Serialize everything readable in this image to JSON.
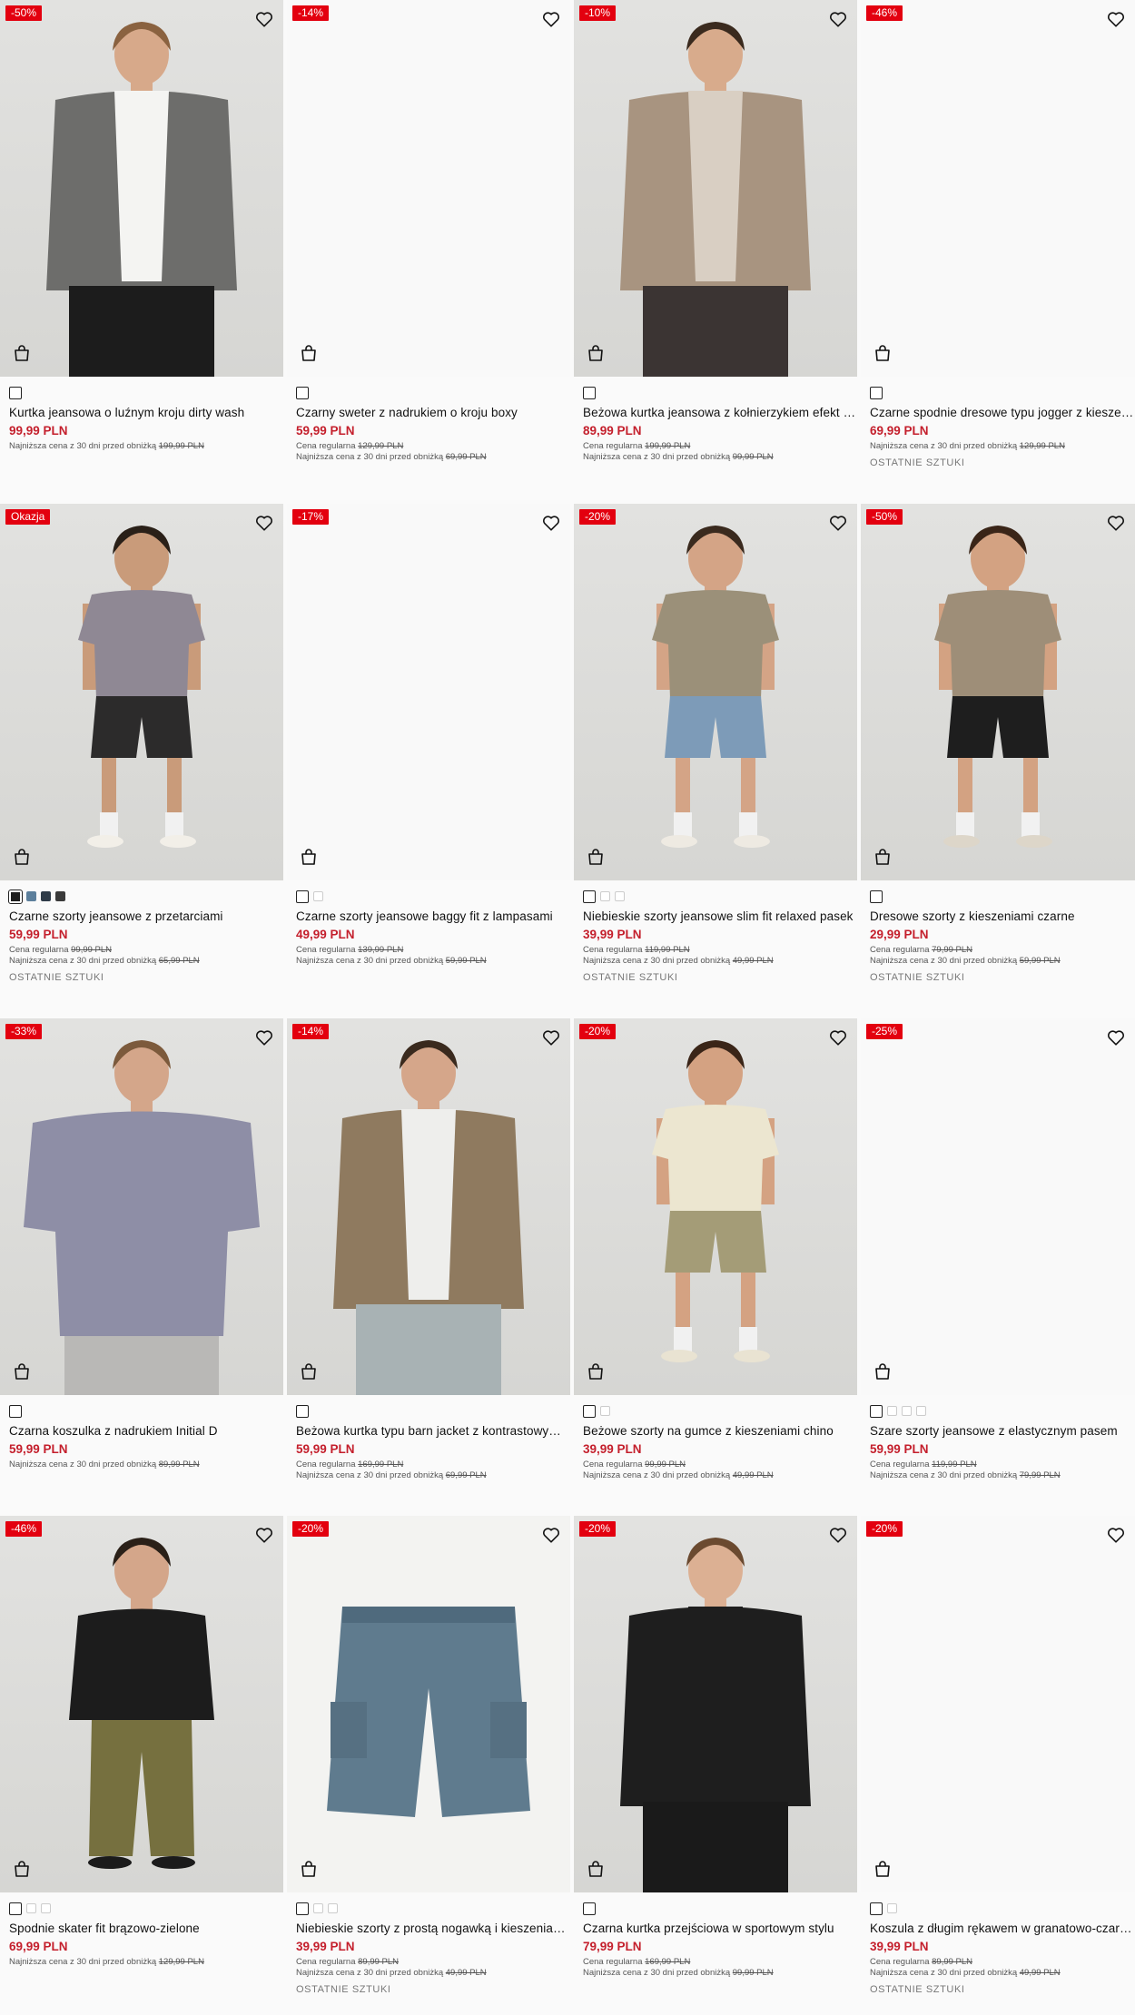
{
  "products": [
    {
      "badge": "-50%",
      "name": "Kurtka jeansowa o luźnym kroju dirty wash",
      "price": "99,99 PLN",
      "regular_label": "",
      "regular_price": "",
      "lowest_label": "Najniższa cena z 30 dni przed obniżką",
      "lowest_price": "199,99 PLN",
      "stock": "",
      "colors": [
        "#ffffff"
      ]
    },
    {
      "badge": "-14%",
      "name": "Czarny sweter z nadrukiem o kroju boxy",
      "price": "59,99 PLN",
      "regular_label": "Cena regularna",
      "regular_price": "129,99 PLN",
      "lowest_label": "Najniższa cena z 30 dni przed obniżką",
      "lowest_price": "69,99 PLN",
      "stock": "",
      "colors": [
        "#ffffff"
      ]
    },
    {
      "badge": "-10%",
      "name": "Beżowa kurtka jeansowa z kołnierzykiem efekt sztruksu",
      "price": "89,99 PLN",
      "regular_label": "Cena regularna",
      "regular_price": "199,99 PLN",
      "lowest_label": "Najniższa cena z 30 dni przed obniżką",
      "lowest_price": "99,99 PLN",
      "stock": "",
      "colors": [
        "#ffffff"
      ]
    },
    {
      "badge": "-46%",
      "name": "Czarne spodnie dresowe typu jogger z kieszeniami",
      "price": "69,99 PLN",
      "regular_label": "",
      "regular_price": "",
      "lowest_label": "Najniższa cena z 30 dni przed obniżką",
      "lowest_price": "129,99 PLN",
      "stock": "OSTATNIE SZTUKI",
      "colors": [
        "#ffffff"
      ]
    },
    {
      "badge": "Okazja",
      "name": "Czarne szorty jeansowe z przetarciami",
      "price": "59,99 PLN",
      "regular_label": "Cena regularna",
      "regular_price": "99,99 PLN",
      "lowest_label": "Najniższa cena z 30 dni przed obniżką",
      "lowest_price": "65,99 PLN",
      "stock": "OSTATNIE SZTUKI",
      "colors": [
        "#1d1d1d",
        "#5c7f9c",
        "#2f3b48",
        "#3a3a3a"
      ]
    },
    {
      "badge": "-17%",
      "name": "Czarne szorty jeansowe baggy fit z lampasami",
      "price": "49,99 PLN",
      "regular_label": "Cena regularna",
      "regular_price": "139,99 PLN",
      "lowest_label": "Najniższa cena z 30 dni przed obniżką",
      "lowest_price": "59,99 PLN",
      "stock": "",
      "colors": [
        "#ffffff",
        "#ffffff"
      ]
    },
    {
      "badge": "-20%",
      "name": "Niebieskie szorty jeansowe slim fit relaxed pasek",
      "price": "39,99 PLN",
      "regular_label": "Cena regularna",
      "regular_price": "119,99 PLN",
      "lowest_label": "Najniższa cena z 30 dni przed obniżką",
      "lowest_price": "49,99 PLN",
      "stock": "OSTATNIE SZTUKI",
      "colors": [
        "#ffffff",
        "#ffffff",
        "#ffffff"
      ]
    },
    {
      "badge": "-50%",
      "name": "Dresowe szorty z kieszeniami czarne",
      "price": "29,99 PLN",
      "regular_label": "Cena regularna",
      "regular_price": "79,99 PLN",
      "lowest_label": "Najniższa cena z 30 dni przed obniżką",
      "lowest_price": "59,99 PLN",
      "stock": "OSTATNIE SZTUKI",
      "colors": [
        "#ffffff"
      ]
    },
    {
      "badge": "-33%",
      "name": "Czarna koszulka z nadrukiem Initial D",
      "price": "59,99 PLN",
      "regular_label": "",
      "regular_price": "",
      "lowest_label": "Najniższa cena z 30 dni przed obniżką",
      "lowest_price": "89,99 PLN",
      "stock": "",
      "colors": [
        "#ffffff"
      ]
    },
    {
      "badge": "-14%",
      "name": "Beżowa kurtka typu barn jacket z kontrastowym kołnierzem",
      "price": "59,99 PLN",
      "regular_label": "Cena regularna",
      "regular_price": "169,99 PLN",
      "lowest_label": "Najniższa cena z 30 dni przed obniżką",
      "lowest_price": "69,99 PLN",
      "stock": "",
      "colors": [
        "#ffffff"
      ]
    },
    {
      "badge": "-20%",
      "name": "Beżowe szorty na gumce z kieszeniami chino",
      "price": "39,99 PLN",
      "regular_label": "Cena regularna",
      "regular_price": "99,99 PLN",
      "lowest_label": "Najniższa cena z 30 dni przed obniżką",
      "lowest_price": "49,99 PLN",
      "stock": "",
      "colors": [
        "#ffffff",
        "#ffffff"
      ]
    },
    {
      "badge": "-25%",
      "name": "Szare szorty jeansowe z elastycznym pasem",
      "price": "59,99 PLN",
      "regular_label": "Cena regularna",
      "regular_price": "119,99 PLN",
      "lowest_label": "Najniższa cena z 30 dni przed obniżką",
      "lowest_price": "79,99 PLN",
      "stock": "",
      "colors": [
        "#ffffff",
        "#ffffff",
        "#ffffff",
        "#ffffff"
      ]
    },
    {
      "badge": "-46%",
      "name": "Spodnie skater fit brązowo-zielone",
      "price": "69,99 PLN",
      "regular_label": "",
      "regular_price": "",
      "lowest_label": "Najniższa cena z 30 dni przed obniżką",
      "lowest_price": "129,99 PLN",
      "stock": "",
      "colors": [
        "#ffffff",
        "#ffffff",
        "#ffffff"
      ]
    },
    {
      "badge": "-20%",
      "name": "Niebieskie szorty z prostą nogawką i kieszeniami cargo",
      "price": "39,99 PLN",
      "regular_label": "Cena regularna",
      "regular_price": "89,99 PLN",
      "lowest_label": "Najniższa cena z 30 dni przed obniżką",
      "lowest_price": "49,99 PLN",
      "stock": "OSTATNIE SZTUKI",
      "colors": [
        "#ffffff",
        "#ffffff",
        "#ffffff"
      ]
    },
    {
      "badge": "-20%",
      "name": "Czarna kurtka przejściowa w sportowym stylu",
      "price": "79,99 PLN",
      "regular_label": "Cena regularna",
      "regular_price": "169,99 PLN",
      "lowest_label": "Najniższa cena z 30 dni przed obniżką",
      "lowest_price": "99,99 PLN",
      "stock": "",
      "colors": [
        "#ffffff"
      ]
    },
    {
      "badge": "-20%",
      "name": "Koszula z długim rękawem w granatowo-czarną kratkę",
      "price": "39,99 PLN",
      "regular_label": "Cena regularna",
      "regular_price": "89,99 PLN",
      "lowest_label": "Najniższa cena z 30 dni przed obniżką",
      "lowest_price": "49,99 PLN",
      "stock": "OSTATNIE SZTUKI",
      "colors": [
        "#ffffff",
        "#ffffff"
      ]
    }
  ],
  "colors": {
    "badge": "#e3000f",
    "price": "#c41f2c",
    "text": "#111111"
  },
  "icons": {
    "wishlist": "heart-icon",
    "cart": "shopping-bag-icon"
  }
}
